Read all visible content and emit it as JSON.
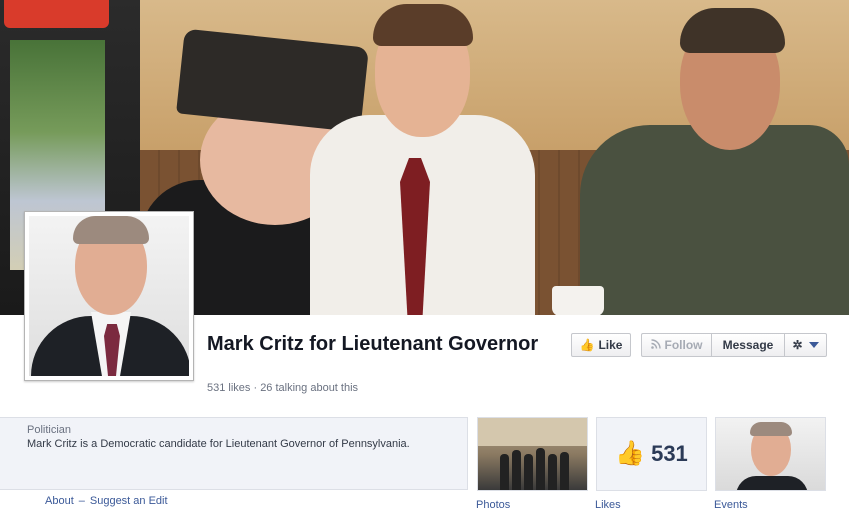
{
  "page": {
    "name": "Mark Critz for Lieutenant Governor",
    "stats": "531 likes · 26 talking about this"
  },
  "actions": {
    "like_label": "Like",
    "follow_label": "Follow",
    "message_label": "Message"
  },
  "about": {
    "category": "Politician",
    "description": "Mark Critz is a Democratic candidate for Lieutenant Governor of Pennsylvania.",
    "about_link": "About",
    "separator": "–",
    "suggest_edit_link": "Suggest an Edit"
  },
  "tiles": {
    "photos_label": "Photos",
    "likes_label": "Likes",
    "likes_count": "531",
    "events_label": "Events"
  },
  "icons": {
    "like": "thumbs-up-icon",
    "follow": "rss-icon",
    "gear": "gear-icon",
    "dropdown": "caret-down-icon"
  },
  "colors": {
    "link": "#3b5998",
    "muted_text": "#6a7180",
    "about_bg": "#f1f3f8"
  }
}
